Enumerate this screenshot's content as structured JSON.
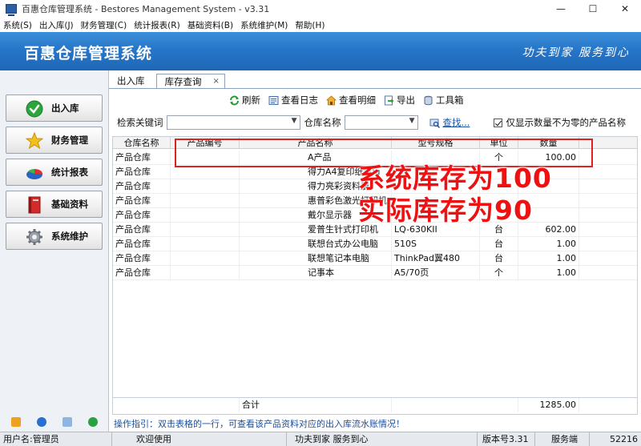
{
  "window": {
    "title": "百惠仓库管理系统 - Bestores Management System - v3.31",
    "min_icon": "—",
    "max_icon": "☐",
    "close_icon": "✕"
  },
  "menu": [
    "系统(S)",
    "出入库(J)",
    "财务管理(C)",
    "统计报表(R)",
    "基础资料(B)",
    "系统维护(M)",
    "帮助(H)"
  ],
  "banner": {
    "title": "百惠仓库管理系统",
    "slogan": "功夫到家 服务到心"
  },
  "sidebar": {
    "items": [
      {
        "label": "出入库",
        "icon": "check-circle-icon"
      },
      {
        "label": "财务管理",
        "icon": "star-icon"
      },
      {
        "label": "统计报表",
        "icon": "pie-chart-icon"
      },
      {
        "label": "基础资料",
        "icon": "book-icon"
      },
      {
        "label": "系统维护",
        "icon": "gear-icon"
      }
    ]
  },
  "tabs": [
    {
      "label": "出入库",
      "active": false
    },
    {
      "label": "库存查询",
      "active": true,
      "close": "×"
    }
  ],
  "toolbar": {
    "refresh": "刷新",
    "log": "查看日志",
    "detail": "查看明细",
    "export": "导出",
    "tools": "工具箱"
  },
  "search": {
    "keyword_label": "检索关键词",
    "keyword_value": "",
    "warehouse_label": "仓库名称",
    "warehouse_value": "",
    "find_link": "查找...",
    "checkbox_label": "仅显示数量不为零的产品名称",
    "checkbox_checked": true
  },
  "table": {
    "columns": [
      "仓库名称",
      "产品编号",
      "产品名称",
      "型号规格",
      "单位",
      "数量"
    ],
    "rows": [
      [
        "产品仓库",
        "",
        "A产品",
        "",
        "个",
        "100.00"
      ],
      [
        "产品仓库",
        "",
        "得力A4复印纸80g",
        "",
        "",
        ""
      ],
      [
        "产品仓库",
        "",
        "得力亮彩资料册",
        "",
        "",
        ""
      ],
      [
        "产品仓库",
        "",
        "惠普彩色激光打印机",
        "",
        "",
        ""
      ],
      [
        "产品仓库",
        "",
        "戴尔显示器",
        "",
        "",
        ""
      ],
      [
        "产品仓库",
        "",
        "爱普生针式打印机",
        "LQ-630KII",
        "台",
        "602.00"
      ],
      [
        "产品仓库",
        "",
        "联想台式办公电脑",
        "510S",
        "台",
        "1.00"
      ],
      [
        "产品仓库",
        "",
        "联想笔记本电脑",
        "ThinkPad翼480",
        "台",
        "1.00"
      ],
      [
        "产品仓库",
        "",
        "记事本",
        "A5/70页",
        "个",
        "1.00"
      ]
    ],
    "total_label": "合计",
    "total_value": "1285.00"
  },
  "hint": "操作指引：双击表格的一行，可查看该产品资料对应的出入库流水账情况！",
  "annotation": {
    "line1": "系统库存为100",
    "line2": "实际库存为90"
  },
  "status": {
    "user": "用户名:管理员",
    "welcome": "欢迎使用",
    "slogan": "功夫到家 服务到心",
    "version": "版本号3.31",
    "mode": "服务端",
    "port": "52216"
  },
  "colors": {
    "banner": "#2676c9",
    "annotation": "#e11111",
    "link": "#1a4fa0"
  }
}
